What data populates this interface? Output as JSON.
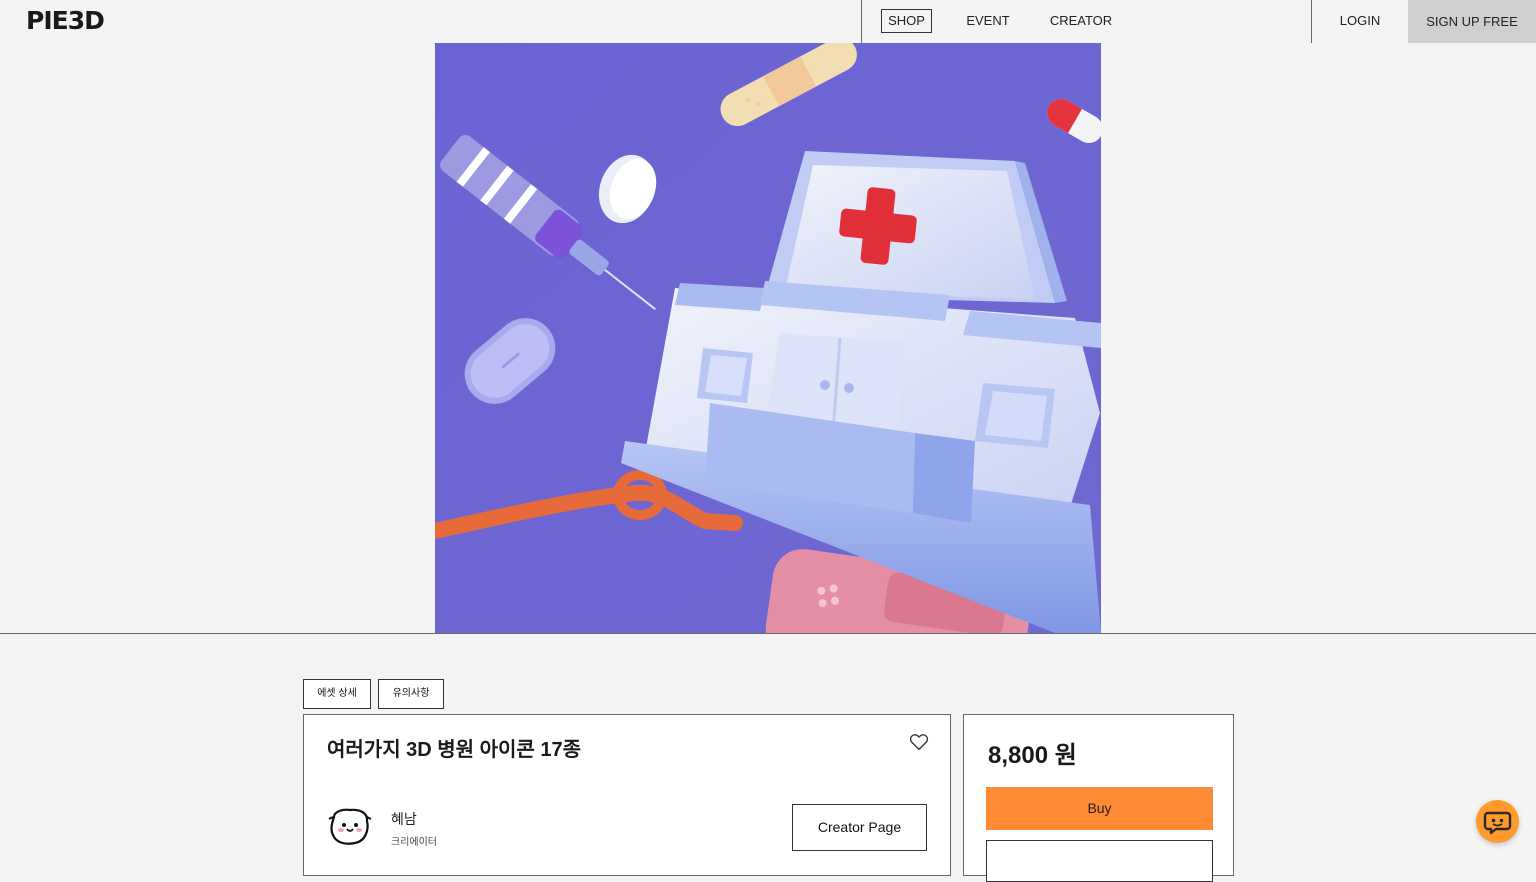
{
  "header": {
    "logo": "PIE3D",
    "nav": {
      "shop": "SHOP",
      "event": "EVENT",
      "creator": "CREATOR"
    },
    "login": "LOGIN",
    "signup": "SIGN UP FREE"
  },
  "tabs": {
    "detail": "에셋 상세",
    "notice": "유의사항"
  },
  "product": {
    "title": "여러가지 3D 병원 아이콘 17종",
    "creator_name": "혜남",
    "creator_role": "크리에이터",
    "creator_page_label": "Creator Page"
  },
  "purchase": {
    "price": "8,800 원",
    "buy_label": "Buy"
  },
  "icons": {
    "like": "heart-icon",
    "chat": "chat-icon",
    "avatar": "avatar-icon"
  },
  "colors": {
    "hero_background": "#6e66d2",
    "buy_button": "#ff8a36",
    "chat_button": "#ff9a2b",
    "signup_background": "#cfcfcf"
  }
}
